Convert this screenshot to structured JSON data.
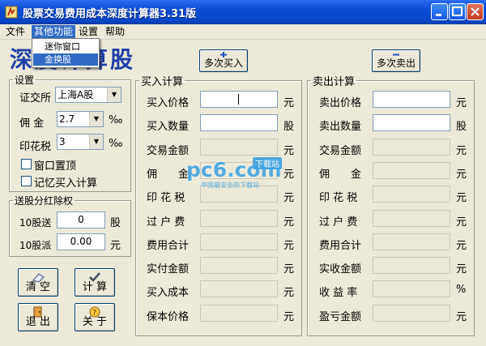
{
  "window": {
    "title": "股票交易费用成本深度计算器3.31版"
  },
  "menu": {
    "file": "文件",
    "other": "其他功能",
    "settings": "设置",
    "help": "帮助"
  },
  "dropdown": {
    "mini": "迷你窗口",
    "skin": "金换股"
  },
  "big_title": "深度计算股",
  "settings": {
    "legend": "设置",
    "exchange_label": "证交所",
    "exchange_value": "上海A股",
    "commission_label": "佣 金",
    "commission_value": "2.7",
    "commission_unit": "‰",
    "stamp_label": "印花税",
    "stamp_value": "3",
    "stamp_unit": "‰",
    "topmost_label": "窗口置顶",
    "remember_label": "记忆买入计算"
  },
  "dividend": {
    "legend": "送股分红除权",
    "bonus_label": "10股送",
    "bonus_value": "0",
    "bonus_unit": "股",
    "cash_label": "10股派",
    "cash_value": "0.00",
    "cash_unit": "元"
  },
  "buttons": {
    "clear": "清 空",
    "calc": "计 算",
    "exit": "退 出",
    "about": "关 于",
    "multi_buy": "多次买入",
    "multi_sell": "多次卖出"
  },
  "buy": {
    "legend": "买入计算",
    "rows": [
      {
        "label": "买入价格",
        "value": "",
        "unit": "元"
      },
      {
        "label": "买入数量",
        "value": "",
        "unit": "股"
      },
      {
        "label": "交易金额",
        "value": "",
        "unit": "元"
      },
      {
        "label": "佣　　金",
        "value": "",
        "unit": "元"
      },
      {
        "label": "印 花 税",
        "value": "",
        "unit": "元"
      },
      {
        "label": "过 户 费",
        "value": "",
        "unit": "元"
      },
      {
        "label": "费用合计",
        "value": "",
        "unit": "元"
      },
      {
        "label": "实付金额",
        "value": "",
        "unit": "元"
      },
      {
        "label": "买入成本",
        "value": "",
        "unit": "元"
      },
      {
        "label": "保本价格",
        "value": "",
        "unit": "元"
      }
    ]
  },
  "sell": {
    "legend": "卖出计算",
    "rows": [
      {
        "label": "卖出价格",
        "value": "",
        "unit": "元"
      },
      {
        "label": "卖出数量",
        "value": "",
        "unit": "股"
      },
      {
        "label": "交易金额",
        "value": "",
        "unit": "元"
      },
      {
        "label": "佣　　金",
        "value": "",
        "unit": "元"
      },
      {
        "label": "印 花 税",
        "value": "",
        "unit": "元"
      },
      {
        "label": "过 户 费",
        "value": "",
        "unit": "元"
      },
      {
        "label": "费用合计",
        "value": "",
        "unit": "元"
      },
      {
        "label": "实收金额",
        "value": "",
        "unit": "元"
      },
      {
        "label": "收 益 率",
        "value": "",
        "unit": "%"
      },
      {
        "label": "盈亏金额",
        "value": "",
        "unit": "元"
      }
    ]
  },
  "watermark": {
    "brand": "pc6.com",
    "badge": "下载站",
    "tagline": "中国最安全的下载站"
  },
  "colors": {
    "titlebar": "#0a4bd6",
    "menu_highlight": "#316ac5",
    "big_title": "#1f3fa8",
    "watermark": "#3aa0e0"
  }
}
